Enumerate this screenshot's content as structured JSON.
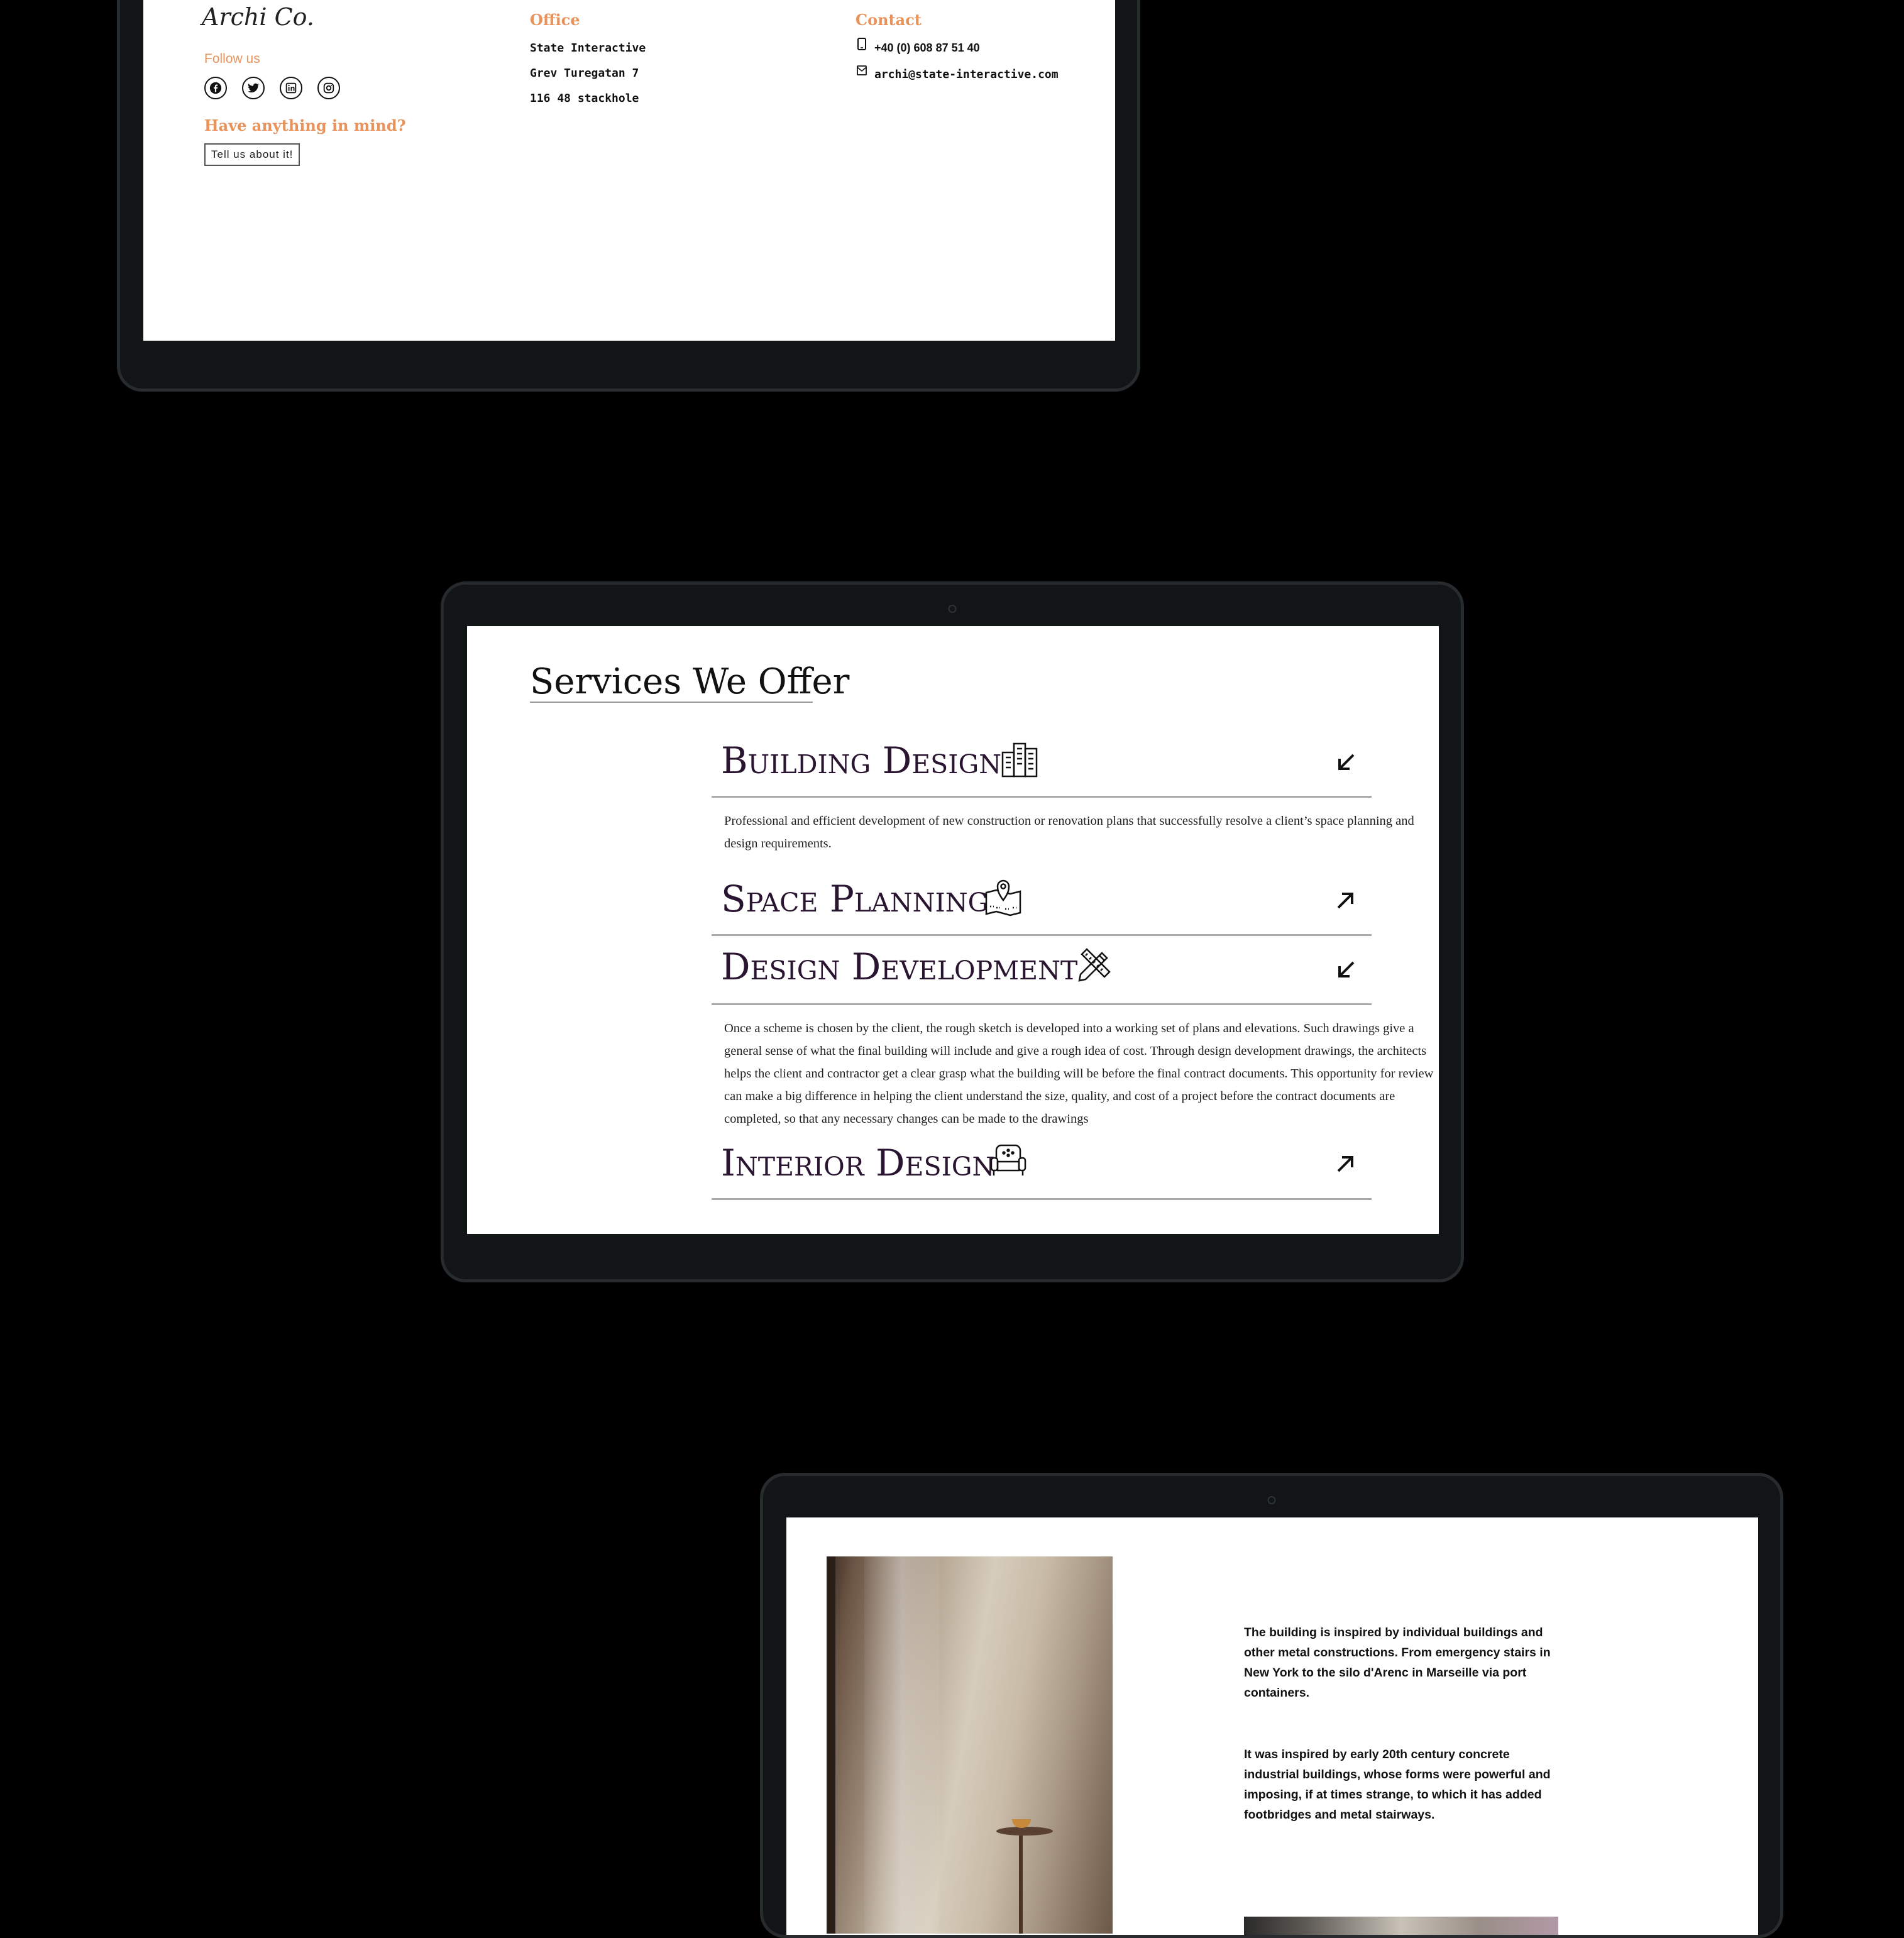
{
  "footer": {
    "logo": "Archi Co.",
    "follow_us": "Follow us",
    "social_icons": [
      "facebook-icon",
      "twitter-icon",
      "linkedin-icon",
      "instagram-icon"
    ],
    "cta_heading": "Have anything in mind?",
    "cta_button": "Tell us about it!",
    "office": {
      "heading": "Office",
      "lines": [
        "State Interactive",
        "Grev Turegatan 7",
        "116 48 stackhole"
      ]
    },
    "contact": {
      "heading": "Contact",
      "phone": "+40 (0) 608 87 51 40",
      "email": "archi@state-interactive.com"
    },
    "accent_color": "#e8935b"
  },
  "services": {
    "title": "Services We Offer",
    "items": [
      {
        "title": "Building Design",
        "icon": "buildings-icon",
        "expanded": true,
        "arrow": "arrow-down-left-icon",
        "description": "Professional and efficient development of new construction or renovation plans that successfully resolve a client’s space planning and design requirements."
      },
      {
        "title": "Space Planning",
        "icon": "map-pin-icon",
        "expanded": false,
        "arrow": "arrow-up-right-icon",
        "description": ""
      },
      {
        "title": "Design Development",
        "icon": "pencil-ruler-icon",
        "expanded": true,
        "arrow": "arrow-down-left-icon",
        "description": "Once a scheme is chosen by the client, the rough sketch is developed into a working set of plans and elevations. Such drawings give a general sense of what the final building will include and give a rough idea of cost. Through design development drawings, the architects helps the client and contractor get a clear grasp what the building will be before the final contract documents. This opportunity for review can make a big difference in helping the client understand the size, quality, and cost of a project before the contract documents are completed, so that any necessary changes can be made to the drawings"
      },
      {
        "title": "Interior Design",
        "icon": "armchair-icon",
        "expanded": false,
        "arrow": "arrow-up-right-icon",
        "description": ""
      }
    ],
    "title_color": "#2a1530"
  },
  "about": {
    "paragraph_1": "The building is inspired by individual buildings and other metal constructions. From emergency stairs in New York to the silo d'Arenc in Marseille via port containers.",
    "paragraph_2": "It was inspired by early 20th century concrete industrial buildings, whose forms were powerful and imposing, if at times strange, to which it has added footbridges and metal stairways."
  }
}
